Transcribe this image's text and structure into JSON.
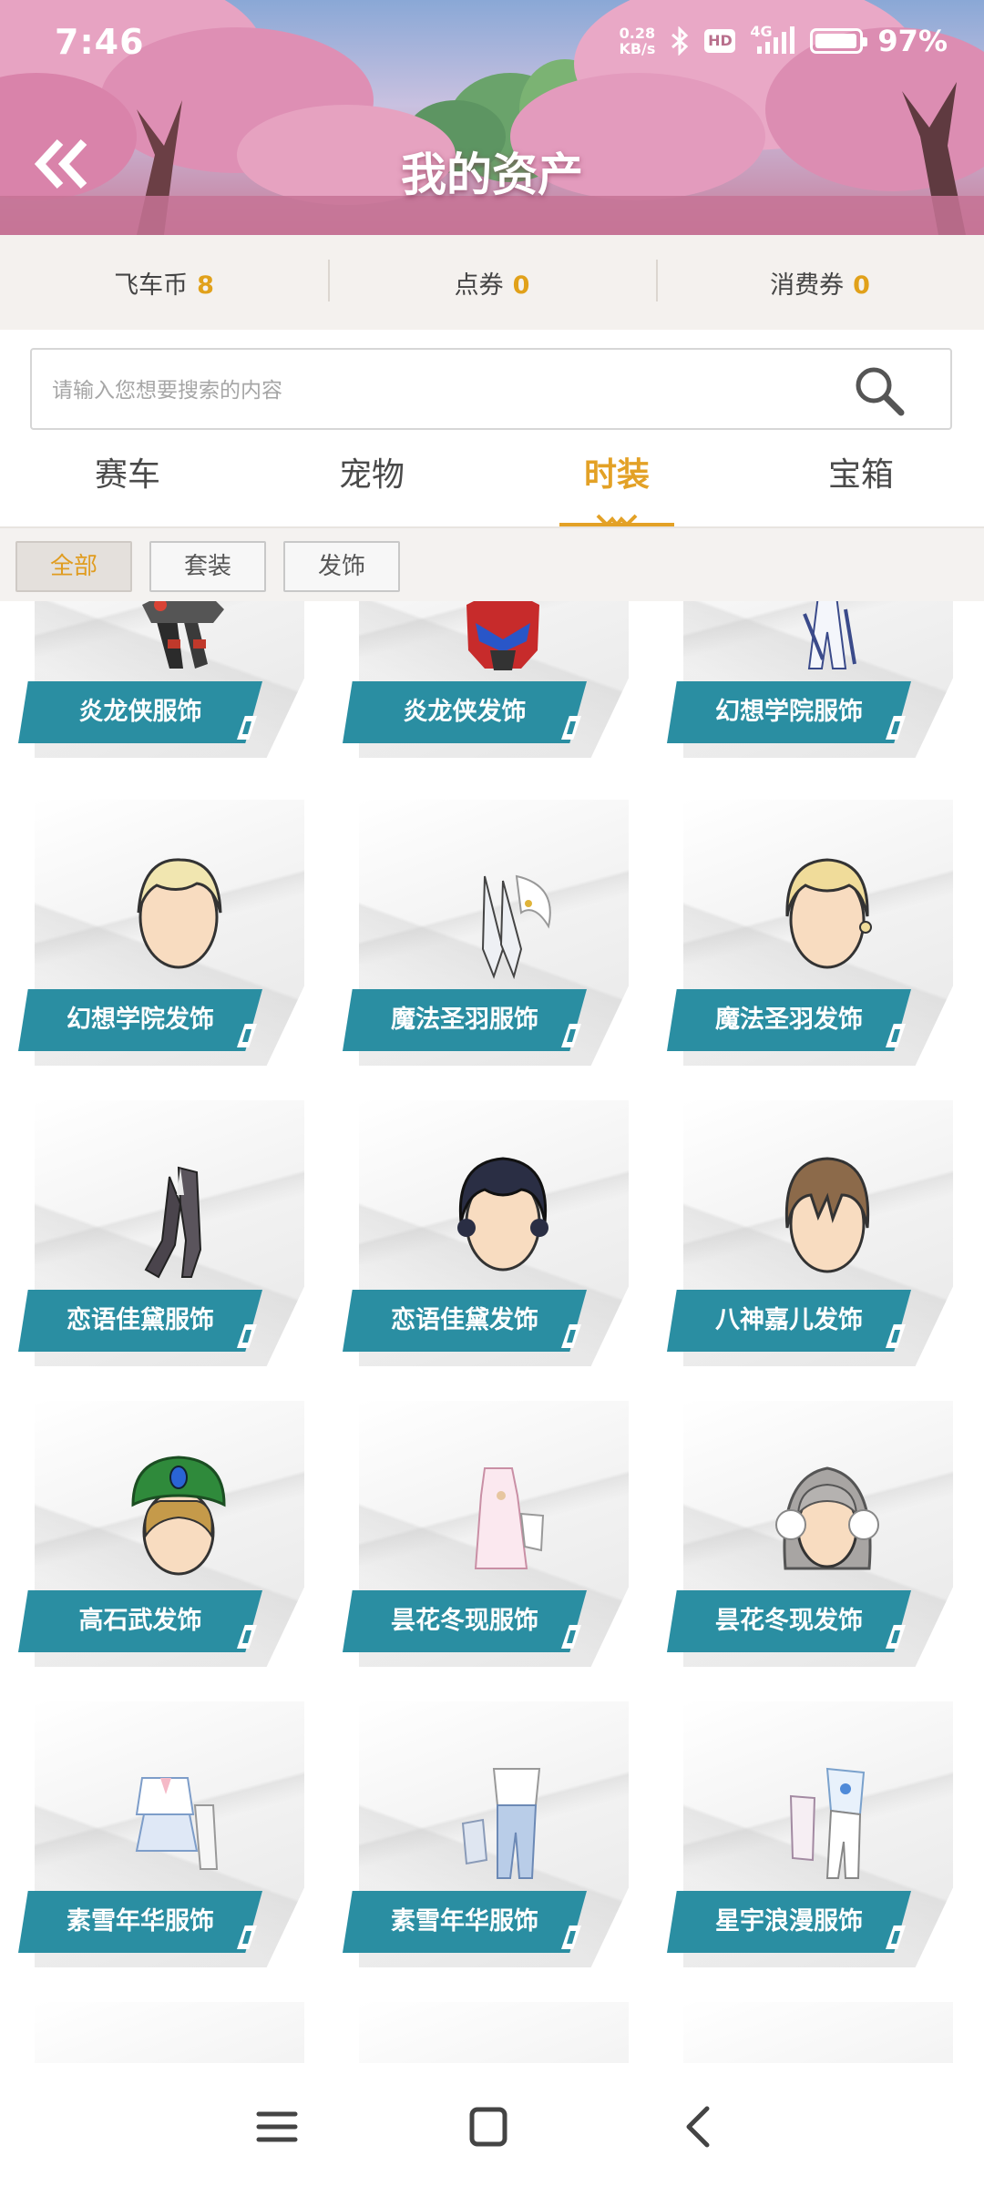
{
  "status_bar": {
    "time": "7:46",
    "net_speed_value": "0.28",
    "net_speed_unit": "KB/s",
    "hd_badge": "HD",
    "network": "4G",
    "battery_percent": "97%",
    "battery_level": 0.97,
    "icons": [
      "bluetooth-icon",
      "signal-icon",
      "battery-icon"
    ]
  },
  "header": {
    "title": "我的资产",
    "back_icon": "double-chevron-left-icon"
  },
  "currencies": [
    {
      "label": "飞车币",
      "value": "8"
    },
    {
      "label": "点券",
      "value": "0"
    },
    {
      "label": "消费券",
      "value": "0"
    }
  ],
  "search": {
    "placeholder": "请输入您想要搜索的内容",
    "value": "",
    "icon": "search-icon"
  },
  "tabs": [
    {
      "label": "赛车",
      "active": false
    },
    {
      "label": "宠物",
      "active": false
    },
    {
      "label": "时装",
      "active": true
    },
    {
      "label": "宝箱",
      "active": false
    }
  ],
  "filters": [
    {
      "label": "全部",
      "active": true
    },
    {
      "label": "套装",
      "active": false
    },
    {
      "label": "发饰",
      "active": false
    }
  ],
  "items": [
    {
      "name": "炎龙侠服饰",
      "icon": "armor-outfit-icon"
    },
    {
      "name": "炎龙侠发饰",
      "icon": "helmet-icon"
    },
    {
      "name": "幻想学院服饰",
      "icon": "white-outfit-icon"
    },
    {
      "name": "幻想学院发饰",
      "icon": "blonde-hair-icon"
    },
    {
      "name": "魔法圣羽服饰",
      "icon": "winged-outfit-icon"
    },
    {
      "name": "魔法圣羽发饰",
      "icon": "blonde-curly-hair-icon"
    },
    {
      "name": "恋语佳黛服饰",
      "icon": "dark-suit-icon"
    },
    {
      "name": "恋语佳黛发饰",
      "icon": "dark-curly-hair-icon"
    },
    {
      "name": "八神嘉儿发饰",
      "icon": "brown-hair-icon"
    },
    {
      "name": "高石武发饰",
      "icon": "green-hat-icon"
    },
    {
      "name": "昙花冬现服饰",
      "icon": "pink-dress-icon"
    },
    {
      "name": "昙花冬现发饰",
      "icon": "silver-hair-earmuffs-icon"
    },
    {
      "name": "素雪年华服饰",
      "icon": "school-uniform-icon"
    },
    {
      "name": "素雪年华服饰",
      "icon": "blue-jeans-outfit-icon"
    },
    {
      "name": "星宇浪漫服饰",
      "icon": "starry-outfit-icon"
    }
  ],
  "colors": {
    "accent": "#e3a126",
    "label_bg": "#2a8ea2",
    "currency_value": "#e1a11a"
  },
  "navbar": {
    "icons": [
      "menu-icon",
      "home-square-icon",
      "back-chevron-icon"
    ]
  }
}
